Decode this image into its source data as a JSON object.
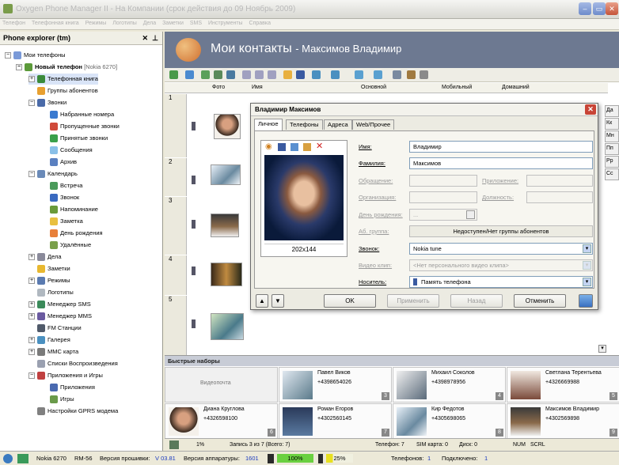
{
  "window": {
    "title": "Oxygen Phone Manager II - На Компании (срок действия до 09 Ноябрь 2009)"
  },
  "menu": [
    "Телефон",
    "Телефонная книга",
    "Режимы",
    "Логотипы",
    "Дела",
    "Заметки",
    "SMS",
    "Инструменты",
    "Справка"
  ],
  "explorer": {
    "title": "Phone explorer (tm)",
    "items": [
      {
        "label": "Мои телефоны"
      },
      {
        "label": "Новый телефон",
        "suffix": "[Nokia 6270]"
      },
      {
        "label": "Телефонная книга"
      },
      {
        "label": "Группы абонентов"
      },
      {
        "label": "Звонки"
      },
      {
        "label": "Набранные номера"
      },
      {
        "label": "Пропущенные звонки"
      },
      {
        "label": "Принятые звонки"
      },
      {
        "label": "Сообщения"
      },
      {
        "label": "Архив"
      },
      {
        "label": "Календарь"
      },
      {
        "label": "Встреча"
      },
      {
        "label": "Звонок"
      },
      {
        "label": "Напоминание"
      },
      {
        "label": "Заметка"
      },
      {
        "label": "День рождения"
      },
      {
        "label": "Удалённые"
      },
      {
        "label": "Дела"
      },
      {
        "label": "Заметки"
      },
      {
        "label": "Режимы"
      },
      {
        "label": "Логотипы"
      },
      {
        "label": "Менеджер SMS"
      },
      {
        "label": "Менеджер MMS"
      },
      {
        "label": "FM Станции"
      },
      {
        "label": "Галерея"
      },
      {
        "label": "MMC карта"
      },
      {
        "label": "Списки Воспроизведения"
      },
      {
        "label": "Приложения и Игры"
      },
      {
        "label": "Приложения"
      },
      {
        "label": "Игры"
      },
      {
        "label": "Настройки GPRS модема"
      }
    ]
  },
  "banner": {
    "title": "Мои контакты",
    "subtitle": "- Максимов Владимир"
  },
  "columns": {
    "photo": "Фото",
    "name": "Имя",
    "main": "Основной",
    "mobile": "Мобильный",
    "home": "Домашний"
  },
  "rows": [
    "1",
    "2",
    "3",
    "4",
    "5"
  ],
  "right_strip": [
    "Да",
    "Кк",
    "Мн",
    "Пп",
    "Рр",
    "Сс"
  ],
  "quick": {
    "title": "Быстрые наборы",
    "voicemail": "Видеопочта",
    "cards": [
      {
        "name": "Павел Виков",
        "phone": "+4398654026",
        "n": "3"
      },
      {
        "name": "Михаил Соколов",
        "phone": "+4398978956",
        "n": "4"
      },
      {
        "name": "Светлана Терентьева",
        "phone": "+4326669988",
        "n": "5"
      },
      {
        "name": "Диана Круглова",
        "phone": "+4326598100",
        "n": "6"
      },
      {
        "name": "Роман Егоров",
        "phone": "+4302560145",
        "n": "7"
      },
      {
        "name": "Кир Федотов",
        "phone": "+4305698065",
        "n": "8"
      },
      {
        "name": "Максимов Владимир",
        "phone": "+4302569898",
        "n": "9"
      }
    ]
  },
  "status": {
    "pct": "1%",
    "record": "Запись 3 из 7 (Всего: 7)",
    "phone": "Телефон: 7",
    "sim": "SIM карта: 0",
    "disk": "Диск: 0",
    "num": "NUM",
    "scrl": "SCRL"
  },
  "bottom": {
    "model": "Nokia 6270",
    "rm": "RM-56",
    "fw_label": "Версия прошивки:",
    "fw": "V 03.81",
    "hw_label": "Версия аппаратуры:",
    "hw": "1601",
    "signal": "100%",
    "battery": "25%",
    "phones_label": "Телефонов:",
    "phones": "1",
    "connected_label": "Подключено:",
    "connected": "1"
  },
  "dialog": {
    "title": "Владимир Максимов",
    "tabs": [
      "Личное",
      "Телефоны",
      "Адреса",
      "Web/Прочее"
    ],
    "photo_size": "202x144",
    "labels": {
      "first": "Имя:",
      "last": "Фамилия:",
      "greeting": "Обращение:",
      "suffix": "Приложение:",
      "org": "Организация:",
      "position": "Должность:",
      "birthday": "День рождения:",
      "group": "Аб. группа:",
      "ringtone": "Звонок:",
      "video": "Видео клип:",
      "storage": "Носитель:"
    },
    "values": {
      "first": "Владимир",
      "last": "Максимов",
      "birthday": "...",
      "group": "Недоступен/Нет группы абонентов",
      "ringtone": "Nokia tune",
      "video": "<Нет персонального видео клипа>",
      "storage": "Память телефона"
    },
    "buttons": {
      "ok": "OK",
      "apply": "Применить",
      "back": "Назад",
      "cancel": "Отменить"
    }
  },
  "colors": {
    "banner": "#6d7991",
    "selection": "#d9e4f7",
    "accent": "#316ac5"
  }
}
